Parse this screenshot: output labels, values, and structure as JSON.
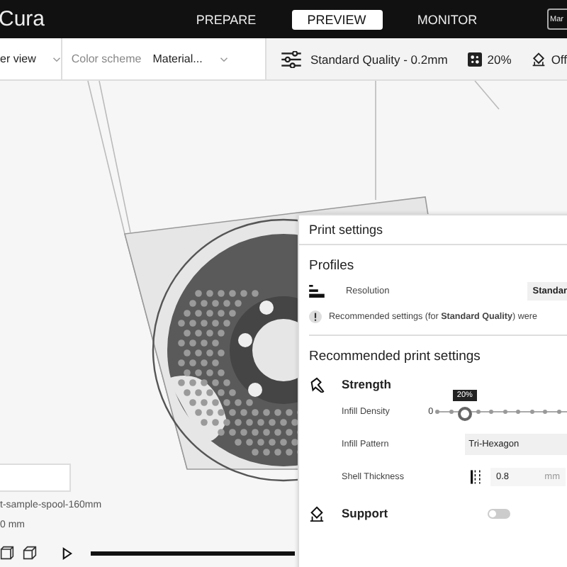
{
  "app": {
    "logo": "Cura",
    "account_button": "Mar"
  },
  "stages": [
    {
      "label": "PREPARE",
      "selected": false
    },
    {
      "label": "PREVIEW",
      "selected": true
    },
    {
      "label": "MONITOR",
      "selected": false
    }
  ],
  "toolbar": {
    "view_type": "er view",
    "color_scheme_label": "Color scheme",
    "color_scheme": "Material...",
    "print_profile": "Standard Quality - 0.2mm",
    "infill": "20%",
    "support": "Off"
  },
  "print_settings": {
    "title": "Print settings",
    "profiles_heading": "Profiles",
    "resolution_label": "Resolution",
    "resolution_value": "Standar",
    "notice": "Recommended settings (for **Standard Quality**) were",
    "recommended_heading": "Recommended print settings",
    "strength_heading": "Strength",
    "infill_density_label": "Infill Density",
    "infill_min": "0",
    "infill_tooltip": "20%",
    "infill": {
      "level": 0.2
    },
    "infill_pattern_label": "Infill Pattern",
    "infill_pattern": "Tri-Hexagon",
    "shell_label": "Shell Thickness",
    "shell_value": "0.8",
    "shell_unit": "mm",
    "support_heading": "Support",
    "support_on": false
  },
  "object_list": {
    "filename": "t-sample-spool-160mm",
    "dimensions": "0 mm"
  },
  "layer_slider": {
    "level": 1
  }
}
